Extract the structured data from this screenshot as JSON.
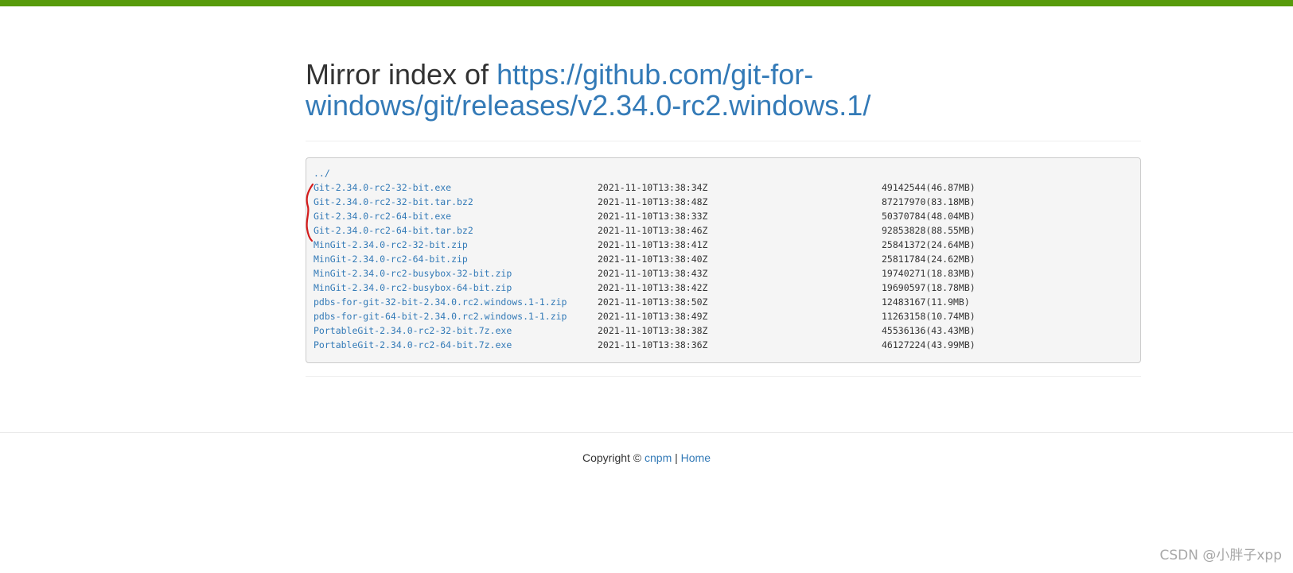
{
  "colors": {
    "topbar": "#589b0c",
    "link": "#337ab7",
    "text": "#333333",
    "annotation": "#d41c1c"
  },
  "header": {
    "prefix": "Mirror index of ",
    "url": "https://github.com/git-for-windows/git/releases/v2.34.0-rc2.windows.1/"
  },
  "listing": {
    "parent_link": "../",
    "files": [
      {
        "name": "Git-2.34.0-rc2-32-bit.exe",
        "date": "2021-11-10T13:38:34Z",
        "size": "49142544(46.87MB)"
      },
      {
        "name": "Git-2.34.0-rc2-32-bit.tar.bz2",
        "date": "2021-11-10T13:38:48Z",
        "size": "87217970(83.18MB)"
      },
      {
        "name": "Git-2.34.0-rc2-64-bit.exe",
        "date": "2021-11-10T13:38:33Z",
        "size": "50370784(48.04MB)"
      },
      {
        "name": "Git-2.34.0-rc2-64-bit.tar.bz2",
        "date": "2021-11-10T13:38:46Z",
        "size": "92853828(88.55MB)"
      },
      {
        "name": "MinGit-2.34.0-rc2-32-bit.zip",
        "date": "2021-11-10T13:38:41Z",
        "size": "25841372(24.64MB)"
      },
      {
        "name": "MinGit-2.34.0-rc2-64-bit.zip",
        "date": "2021-11-10T13:38:40Z",
        "size": "25811784(24.62MB)"
      },
      {
        "name": "MinGit-2.34.0-rc2-busybox-32-bit.zip",
        "date": "2021-11-10T13:38:43Z",
        "size": "19740271(18.83MB)"
      },
      {
        "name": "MinGit-2.34.0-rc2-busybox-64-bit.zip",
        "date": "2021-11-10T13:38:42Z",
        "size": "19690597(18.78MB)"
      },
      {
        "name": "pdbs-for-git-32-bit-2.34.0.rc2.windows.1-1.zip",
        "date": "2021-11-10T13:38:50Z",
        "size": "12483167(11.9MB)"
      },
      {
        "name": "pdbs-for-git-64-bit-2.34.0.rc2.windows.1-1.zip",
        "date": "2021-11-10T13:38:49Z",
        "size": "11263158(10.74MB)"
      },
      {
        "name": "PortableGit-2.34.0-rc2-32-bit.7z.exe",
        "date": "2021-11-10T13:38:38Z",
        "size": "45536136(43.43MB)"
      },
      {
        "name": "PortableGit-2.34.0-rc2-64-bit.7z.exe",
        "date": "2021-11-10T13:38:36Z",
        "size": "46127224(43.99MB)"
      }
    ]
  },
  "footer": {
    "copyright": "Copyright © ",
    "cnpm_link": "cnpm",
    "separator": " | ",
    "home_link": "Home"
  },
  "watermark": "CSDN @小胖子xpp"
}
